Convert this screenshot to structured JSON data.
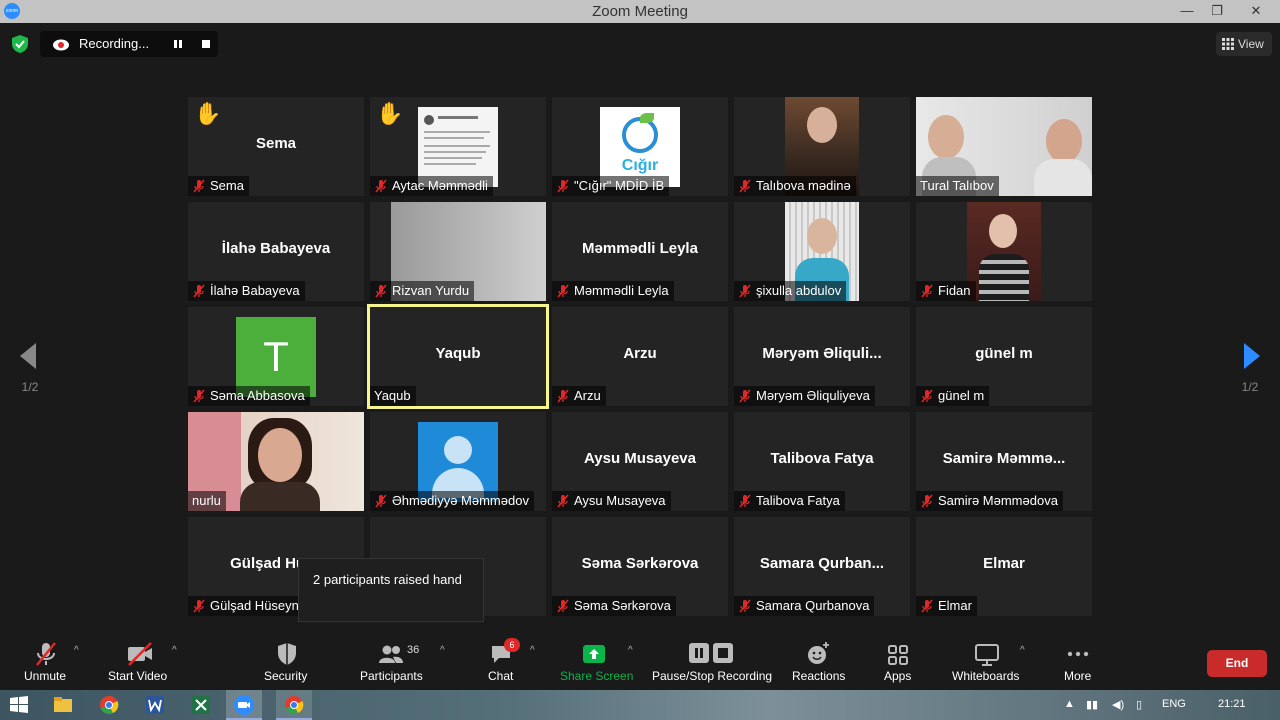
{
  "window": {
    "title": "Zoom Meeting",
    "minimize": "—",
    "maximize": "❐",
    "close": "✕"
  },
  "recording": {
    "label": "Recording..."
  },
  "view": {
    "label": "View"
  },
  "pages": {
    "left": "1/2",
    "right": "1/2"
  },
  "tiles": [
    {
      "center": "Sema",
      "name": "Sema",
      "hand": "✋"
    },
    {
      "center": "",
      "name": "Aytac Məmmədli",
      "hand": "✋"
    },
    {
      "center": "",
      "name": "\"Cığır\" MDİD İB",
      "logo_text": "Cığır"
    },
    {
      "center": "",
      "name": "Talıbova mədinə"
    },
    {
      "center": "",
      "name": "Tural Talıbov"
    },
    {
      "center": "İlahə Babayeva",
      "name": "İlahə Babayeva"
    },
    {
      "center": "",
      "name": "Rizvan Yurdu"
    },
    {
      "center": "Məmmədli Leyla",
      "name": "Məmmədli Leyla"
    },
    {
      "center": "",
      "name": "şixulla abdulov"
    },
    {
      "center": "",
      "name": "Fidan"
    },
    {
      "center": "",
      "name": "Səma Abbasova",
      "avatar_letter": "T"
    },
    {
      "center": "Yaqub",
      "name": "Yaqub"
    },
    {
      "center": "Arzu",
      "name": "Arzu"
    },
    {
      "center": "Məryəm  Əliquli...",
      "name": "Məryəm Əliquliyeva"
    },
    {
      "center": "günel m",
      "name": "günel m"
    },
    {
      "center": "",
      "name": "nurlu"
    },
    {
      "center": "",
      "name": "Əhmədiyyə Məmmədov"
    },
    {
      "center": "Aysu Musayeva",
      "name": "Aysu Musayeva"
    },
    {
      "center": "Talibova Fatya",
      "name": "Talibova Fatya"
    },
    {
      "center": "Samirə  Məmmə...",
      "name": "Samirə Məmmədova"
    },
    {
      "center": "Gülşad  Hüse",
      "name": "Gülşad Hüseyn"
    },
    {
      "center": "",
      "name": ""
    },
    {
      "center": "Səma Sərkərova",
      "name": "Səma Sərkərova"
    },
    {
      "center": "Samara  Qurban...",
      "name": "Samara Qurbanova"
    },
    {
      "center": "Elmar",
      "name": "Elmar"
    }
  ],
  "toast": {
    "text": "2 participants raised hand"
  },
  "toolbar": {
    "unmute": "Unmute",
    "start_video": "Start Video",
    "security": "Security",
    "participants": "Participants",
    "participants_count": "36",
    "chat": "Chat",
    "chat_badge": "6",
    "share_screen": "Share Screen",
    "pause_stop": "Pause/Stop Recording",
    "reactions": "Reactions",
    "apps": "Apps",
    "whiteboards": "Whiteboards",
    "more": "More",
    "end": "End",
    "caret": "^"
  },
  "taskbar": {
    "lang": "ENG",
    "time": "21:21"
  },
  "colors": {
    "accent": "#2d8cff",
    "share_green": "#0bb34a",
    "end_red": "#c92a2a",
    "muted_red": "#e02828",
    "active_speaker": "#f6f68c"
  }
}
